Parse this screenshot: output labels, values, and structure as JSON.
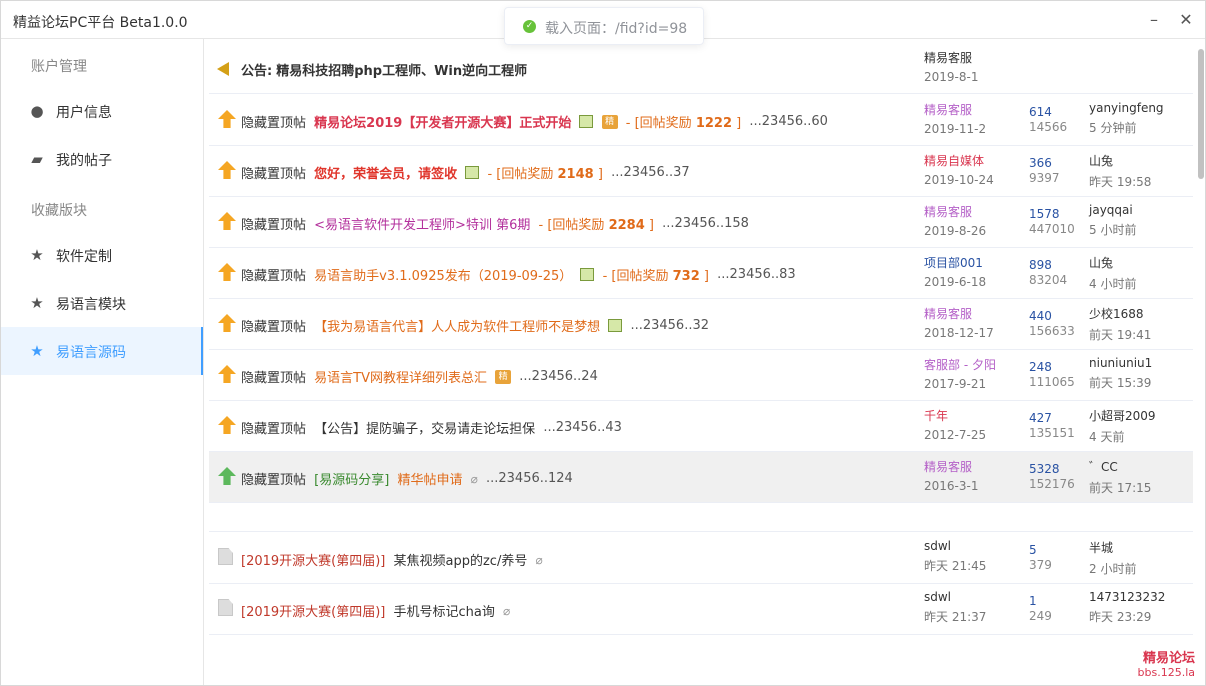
{
  "window": {
    "title": "精益论坛PC平台 Beta1.0.0",
    "min_glyph": "–",
    "close_glyph": "✕"
  },
  "toast": {
    "icon": "check-circle-icon",
    "message": "载入页面：/fid?id=98",
    "color": "#67c23a"
  },
  "sidebar": {
    "groups": [
      "账户管理",
      "收藏版块"
    ],
    "items": [
      {
        "label": "用户信息",
        "icon": "user-circle-icon",
        "glyph": "●"
      },
      {
        "label": "我的帖子",
        "icon": "comment-icon",
        "glyph": "▰"
      },
      {
        "label": "软件定制",
        "icon": "star-icon",
        "glyph": "★"
      },
      {
        "label": "易语言模块",
        "icon": "star-icon",
        "glyph": "★"
      },
      {
        "label": "易语言源码",
        "icon": "star-icon",
        "glyph": "★",
        "active": true
      }
    ],
    "accent": "#409eff"
  },
  "threads": [
    {
      "icon": "announcement-icon",
      "prefix": "公告:",
      "title": "精易科技招聘php工程师、Win逆向工程师",
      "author": "精易客服",
      "date": "2019-8-1"
    },
    {
      "icon": "top-icon",
      "tag": "隐藏置顶帖",
      "title": "精易论坛2019【开发者开源大赛】正式开始",
      "badges": "pic,jing",
      "reward": "1222",
      "reward_label": "回帖奖励",
      "pages": "...23456..60",
      "author": "精易客服",
      "date": "2019-11-2",
      "replies": "614",
      "views": "14566",
      "last_user": "yanyingfeng",
      "last_time": "5 分钟前"
    },
    {
      "icon": "top-icon",
      "tag": "隐藏置顶帖",
      "title": "您好，荣誉会员，请签收",
      "badges": "pic",
      "reward": "2148",
      "reward_label": "回帖奖励",
      "pages": "...23456..37",
      "author": "精易自媒体",
      "date": "2019-10-24",
      "replies": "366",
      "views": "9397",
      "last_user": "山兔",
      "last_time": "昨天 19:58"
    },
    {
      "icon": "top-icon",
      "tag": "隐藏置顶帖",
      "title": "<易语言软件开发工程师>特训 第6期",
      "reward": "2284",
      "reward_label": "回帖奖励",
      "pages": "...23456..158",
      "author": "精易客服",
      "date": "2019-8-26",
      "replies": "1578",
      "views": "447010",
      "last_user": "jayqqai",
      "last_time": "5 小时前"
    },
    {
      "icon": "top-icon",
      "tag": "隐藏置顶帖",
      "title": "易语言助手v3.1.0925发布（2019-09-25）",
      "badges": "pic",
      "reward": "732",
      "reward_label": "回帖奖励",
      "pages": "...23456..83",
      "author": "项目部001",
      "date": "2019-6-18",
      "replies": "898",
      "views": "83204",
      "last_user": "山兔",
      "last_time": "4 小时前"
    },
    {
      "icon": "top-icon",
      "tag": "隐藏置顶帖",
      "title": "【我为易语言代言】人人成为软件工程师不是梦想",
      "badges": "pic",
      "pages": "...23456..32",
      "author": "精易客服",
      "date": "2018-12-17",
      "replies": "440",
      "views": "156633",
      "last_user": "少校1688",
      "last_time": "前天 19:41"
    },
    {
      "icon": "top-icon",
      "tag": "隐藏置顶帖",
      "title": "易语言TV网教程详细列表总汇",
      "badges": "jing",
      "pages": "...23456..24",
      "author": "客服部 - 夕阳",
      "date": "2017-9-21",
      "replies": "248",
      "views": "111065",
      "last_user": "niuniuniu1",
      "last_time": "前天 15:39"
    },
    {
      "icon": "top-icon",
      "tag": "隐藏置顶帖",
      "title": "【公告】提防骗子，交易请走论坛担保",
      "pages": "...23456..43",
      "author": "千年",
      "date": "2012-7-25",
      "replies": "427",
      "views": "135151",
      "last_user": "小超哥2009",
      "last_time": "4 天前"
    },
    {
      "icon": "top-green-icon",
      "tag": "隐藏置顶帖",
      "category": "[易源码分享]",
      "title": "精华帖申请",
      "pages": "...23456..124",
      "author": "精易客服",
      "date": "2016-3-1",
      "replies": "5328",
      "views": "152176",
      "last_user": "゛CC",
      "last_time": "前天 17:15"
    }
  ],
  "normal_threads": [
    {
      "icon": "doc-icon",
      "category": "[2019开源大赛(第四届)]",
      "title": "某焦视频app的zc/养号",
      "author": "sdwl",
      "date": "昨天 21:45",
      "replies": "5",
      "views": "379",
      "last_user": "半城",
      "last_time": "2 小时前"
    },
    {
      "icon": "doc-icon",
      "category": "[2019开源大赛(第四届)]",
      "title": "手机号标记cha询",
      "author": "sdwl",
      "date": "昨天 21:37",
      "replies": "1",
      "views": "249",
      "last_user": "1473123232",
      "last_time": "昨天 23:29"
    }
  ],
  "badge_text": {
    "jing": "精",
    "clip": "⌀"
  },
  "watermark": {
    "line1": "精易论坛",
    "line2": "bbs.125.la"
  }
}
